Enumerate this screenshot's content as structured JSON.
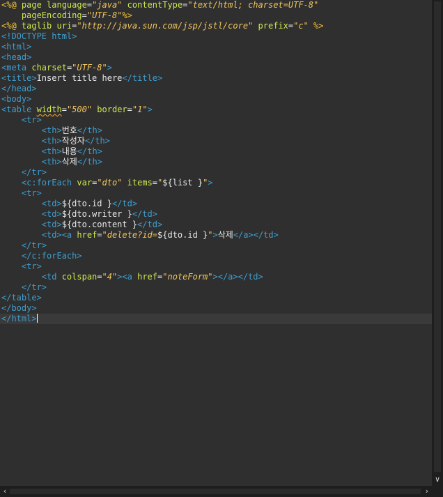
{
  "editor": {
    "lines": [
      [
        {
          "c": "dir",
          "t": "<%@ "
        },
        {
          "c": "attr",
          "t": "page "
        },
        {
          "c": "attr",
          "t": "language"
        },
        {
          "c": "txt",
          "t": "="
        },
        {
          "c": "str",
          "t": "\"java\""
        },
        {
          "c": "txt",
          "t": " "
        },
        {
          "c": "attr",
          "t": "contentType"
        },
        {
          "c": "txt",
          "t": "="
        },
        {
          "c": "str",
          "t": "\"text/html; charset=UTF-8\""
        }
      ],
      [
        {
          "c": "txt",
          "t": "    "
        },
        {
          "c": "attr",
          "t": "pageEncoding"
        },
        {
          "c": "txt",
          "t": "="
        },
        {
          "c": "str",
          "t": "\"UTF-8\""
        },
        {
          "c": "dir",
          "t": "%>"
        }
      ],
      [
        {
          "c": "dir",
          "t": "<%@ "
        },
        {
          "c": "attr",
          "t": "taglib "
        },
        {
          "c": "attr",
          "t": "uri"
        },
        {
          "c": "txt",
          "t": "="
        },
        {
          "c": "str",
          "t": "\"http://java.sun.com/jsp/jstl/core\""
        },
        {
          "c": "txt",
          "t": " "
        },
        {
          "c": "attr",
          "t": "prefix"
        },
        {
          "c": "txt",
          "t": "="
        },
        {
          "c": "str",
          "t": "\"c\""
        },
        {
          "c": "txt",
          "t": " "
        },
        {
          "c": "dir",
          "t": "%>"
        }
      ],
      [
        {
          "c": "kw",
          "t": "<!DOCTYPE html>"
        }
      ],
      [
        {
          "c": "kw",
          "t": "<html>"
        }
      ],
      [
        {
          "c": "kw",
          "t": "<head>"
        }
      ],
      [
        {
          "c": "kw",
          "t": "<meta "
        },
        {
          "c": "attr",
          "t": "charset"
        },
        {
          "c": "txt",
          "t": "="
        },
        {
          "c": "str",
          "t": "\"UTF-8\""
        },
        {
          "c": "kw",
          "t": ">"
        }
      ],
      [
        {
          "c": "kw",
          "t": "<title>"
        },
        {
          "c": "txt",
          "t": "Insert title here"
        },
        {
          "c": "kw",
          "t": "</title>"
        }
      ],
      [
        {
          "c": "kw",
          "t": "</head>"
        }
      ],
      [
        {
          "c": "kw",
          "t": "<body>"
        }
      ],
      [
        {
          "c": "kw",
          "t": "<table "
        },
        {
          "c": "sq",
          "t": "width"
        },
        {
          "c": "txt",
          "t": "="
        },
        {
          "c": "str",
          "t": "\"500\""
        },
        {
          "c": "txt",
          "t": " "
        },
        {
          "c": "attr",
          "t": "border"
        },
        {
          "c": "txt",
          "t": "="
        },
        {
          "c": "str",
          "t": "\"1\""
        },
        {
          "c": "kw",
          "t": ">"
        }
      ],
      [
        {
          "c": "txt",
          "t": "    "
        },
        {
          "c": "kw",
          "t": "<tr>"
        }
      ],
      [
        {
          "c": "txt",
          "t": "        "
        },
        {
          "c": "kw",
          "t": "<th>"
        },
        {
          "c": "txt",
          "t": "번호"
        },
        {
          "c": "kw",
          "t": "</th>"
        }
      ],
      [
        {
          "c": "txt",
          "t": "        "
        },
        {
          "c": "kw",
          "t": "<th>"
        },
        {
          "c": "txt",
          "t": "작성자"
        },
        {
          "c": "kw",
          "t": "</th>"
        }
      ],
      [
        {
          "c": "txt",
          "t": "        "
        },
        {
          "c": "kw",
          "t": "<th>"
        },
        {
          "c": "txt",
          "t": "내용"
        },
        {
          "c": "kw",
          "t": "</th>"
        }
      ],
      [
        {
          "c": "txt",
          "t": "        "
        },
        {
          "c": "kw",
          "t": "<th>"
        },
        {
          "c": "txt",
          "t": "삭제"
        },
        {
          "c": "kw",
          "t": "</th>"
        }
      ],
      [
        {
          "c": "txt",
          "t": "    "
        },
        {
          "c": "kw",
          "t": "</tr>"
        }
      ],
      [
        {
          "c": "txt",
          "t": "    "
        },
        {
          "c": "kw",
          "t": "<c:forEach "
        },
        {
          "c": "attr",
          "t": "var"
        },
        {
          "c": "txt",
          "t": "="
        },
        {
          "c": "str",
          "t": "\"dto\""
        },
        {
          "c": "txt",
          "t": " "
        },
        {
          "c": "attr",
          "t": "items"
        },
        {
          "c": "txt",
          "t": "="
        },
        {
          "c": "str",
          "t": "\""
        },
        {
          "c": "txt",
          "t": "${list }"
        },
        {
          "c": "str",
          "t": "\""
        },
        {
          "c": "kw",
          "t": ">"
        }
      ],
      [
        {
          "c": "txt",
          "t": "    "
        },
        {
          "c": "kw",
          "t": "<tr>"
        }
      ],
      [
        {
          "c": "txt",
          "t": "        "
        },
        {
          "c": "kw",
          "t": "<td>"
        },
        {
          "c": "txt",
          "t": "${dto.id }"
        },
        {
          "c": "kw",
          "t": "</td>"
        }
      ],
      [
        {
          "c": "txt",
          "t": "        "
        },
        {
          "c": "kw",
          "t": "<td>"
        },
        {
          "c": "txt",
          "t": "${dto.writer }"
        },
        {
          "c": "kw",
          "t": "</td>"
        }
      ],
      [
        {
          "c": "txt",
          "t": "        "
        },
        {
          "c": "kw",
          "t": "<td>"
        },
        {
          "c": "txt",
          "t": "${dto.content }"
        },
        {
          "c": "kw",
          "t": "</td>"
        }
      ],
      [
        {
          "c": "txt",
          "t": "        "
        },
        {
          "c": "kw",
          "t": "<td>"
        },
        {
          "c": "kw",
          "t": "<a "
        },
        {
          "c": "attr",
          "t": "href"
        },
        {
          "c": "txt",
          "t": "="
        },
        {
          "c": "str",
          "t": "\"delete?id="
        },
        {
          "c": "txt",
          "t": "${dto.id }"
        },
        {
          "c": "str",
          "t": "\""
        },
        {
          "c": "kw",
          "t": ">"
        },
        {
          "c": "txt",
          "t": "삭제"
        },
        {
          "c": "kw",
          "t": "</a></td>"
        }
      ],
      [
        {
          "c": "txt",
          "t": "    "
        },
        {
          "c": "kw",
          "t": "</tr>"
        }
      ],
      [
        {
          "c": "txt",
          "t": "    "
        },
        {
          "c": "kw",
          "t": "</c:forEach>"
        }
      ],
      [
        {
          "c": "txt",
          "t": "    "
        },
        {
          "c": "kw",
          "t": "<tr>"
        }
      ],
      [
        {
          "c": "txt",
          "t": "        "
        },
        {
          "c": "kw",
          "t": "<td "
        },
        {
          "c": "attr",
          "t": "colspan"
        },
        {
          "c": "txt",
          "t": "="
        },
        {
          "c": "str",
          "t": "\"4\""
        },
        {
          "c": "kw",
          "t": "><a "
        },
        {
          "c": "attr",
          "t": "href"
        },
        {
          "c": "txt",
          "t": "="
        },
        {
          "c": "str",
          "t": "\"noteForm\""
        },
        {
          "c": "kw",
          "t": "></a></td>"
        }
      ],
      [
        {
          "c": "txt",
          "t": "    "
        },
        {
          "c": "kw",
          "t": "</tr>"
        }
      ],
      [
        {
          "c": "kw",
          "t": "</table>"
        }
      ],
      [
        {
          "c": "kw",
          "t": "</body>"
        }
      ],
      [
        {
          "c": "kw",
          "t": "</html>"
        }
      ]
    ],
    "current_line": 30
  },
  "colors": {
    "background": "#2f2f2f",
    "tag": "#3e9ecf",
    "attribute": "#cfe84e",
    "string": "#f2c55c",
    "directive": "#f1c232",
    "text": "#e8e8e8"
  },
  "scrollbars": {
    "vertical_down_icon": "chevron-down-icon",
    "horizontal_left_icon": "chevron-left-icon",
    "horizontal_right_icon": "chevron-right-icon"
  }
}
